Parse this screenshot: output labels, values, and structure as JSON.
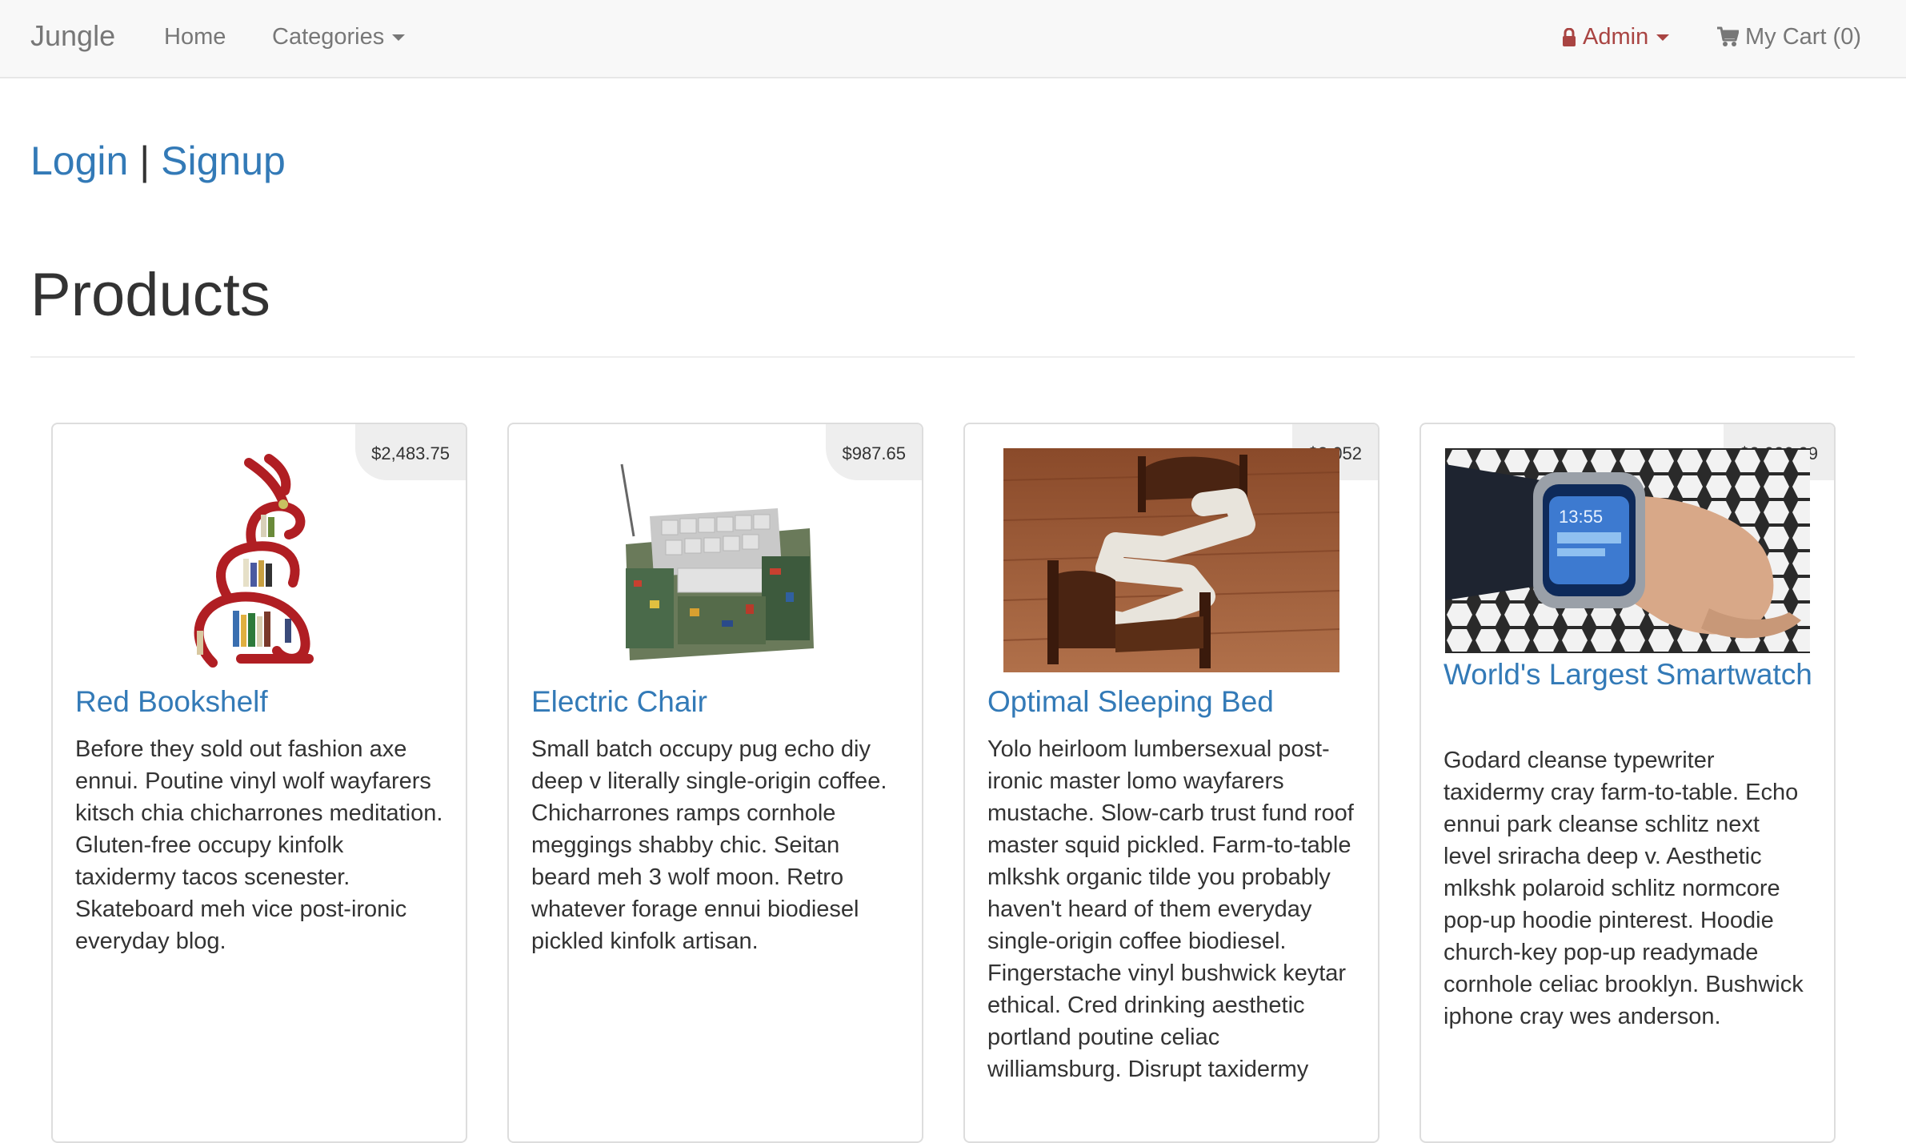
{
  "navbar": {
    "brand": "Jungle",
    "home": "Home",
    "categories": "Categories",
    "admin": "Admin",
    "cart": "My Cart (0)"
  },
  "auth": {
    "login": "Login",
    "separator": "|",
    "signup": "Signup"
  },
  "page_title": "Products",
  "colors": {
    "link": "#337ab7",
    "admin": "#a94442",
    "navbar_bg": "#f8f8f8"
  },
  "products": [
    {
      "name": "Red Bookshelf",
      "price": "$2,483.75",
      "description": "Before they sold out fashion axe ennui. Poutine vinyl wolf wayfarers kitsch chia chicharrones meditation. Gluten-free occupy kinfolk taxidermy tacos scenester. Skateboard meh vice post-ironic everyday blog."
    },
    {
      "name": "Electric Chair",
      "price": "$987.65",
      "description": "Small batch occupy pug echo diy deep v literally single-origin coffee. Chicharrones ramps cornhole meggings shabby chic. Seitan beard meh 3 wolf moon. Retro whatever forage ennui biodiesel pickled kinfolk artisan."
    },
    {
      "name": "Optimal Sleeping Bed",
      "price": "$3,052",
      "description": "Yolo heirloom lumbersexual post-ironic master lomo wayfarers mustache. Slow-carb trust fund roof master squid pickled. Farm-to-table mlkshk organic tilde you probably haven't heard of them everyday single-origin coffee biodiesel. Fingerstache vinyl bushwick keytar ethical. Cred drinking aesthetic portland poutine celiac williamsburg. Disrupt taxidermy"
    },
    {
      "name": "World's Largest Smartwatch",
      "price": "$2,026.29",
      "description": "Godard cleanse typewriter taxidermy cray farm-to-table. Echo ennui park cleanse schlitz next level sriracha deep v. Aesthetic mlkshk polaroid schlitz normcore pop-up hoodie pinterest. Hoodie church-key pop-up readymade cornhole celiac brooklyn. Bushwick iphone cray wes anderson.",
      "image_text": "13:55"
    }
  ]
}
